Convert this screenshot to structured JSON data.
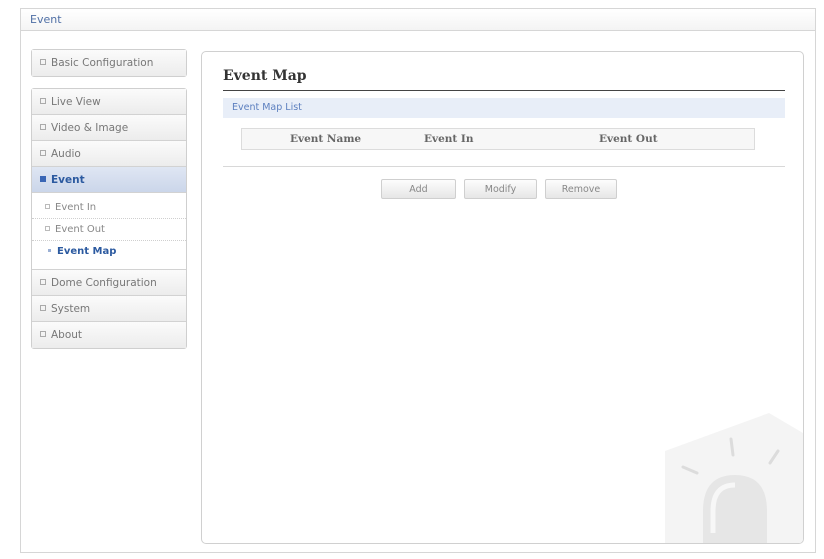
{
  "window": {
    "title": "Event"
  },
  "sidebar": {
    "items": [
      {
        "label": "Basic Configuration"
      },
      {
        "label": "Live View"
      },
      {
        "label": "Video & Image"
      },
      {
        "label": "Audio"
      },
      {
        "label": "Event"
      },
      {
        "label": "Dome Configuration"
      },
      {
        "label": "System"
      },
      {
        "label": "About"
      }
    ],
    "event_submenu": [
      {
        "label": "Event In"
      },
      {
        "label": "Event Out"
      },
      {
        "label": "Event Map"
      }
    ]
  },
  "main": {
    "title": "Event Map",
    "section": "Event Map List",
    "columns": [
      "Event Name",
      "Event In",
      "Event Out"
    ],
    "buttons": {
      "add": "Add",
      "modify": "Modify",
      "remove": "Remove"
    }
  },
  "colors": {
    "accent": "#2c5aa0",
    "section_bg": "#e8eef8"
  }
}
